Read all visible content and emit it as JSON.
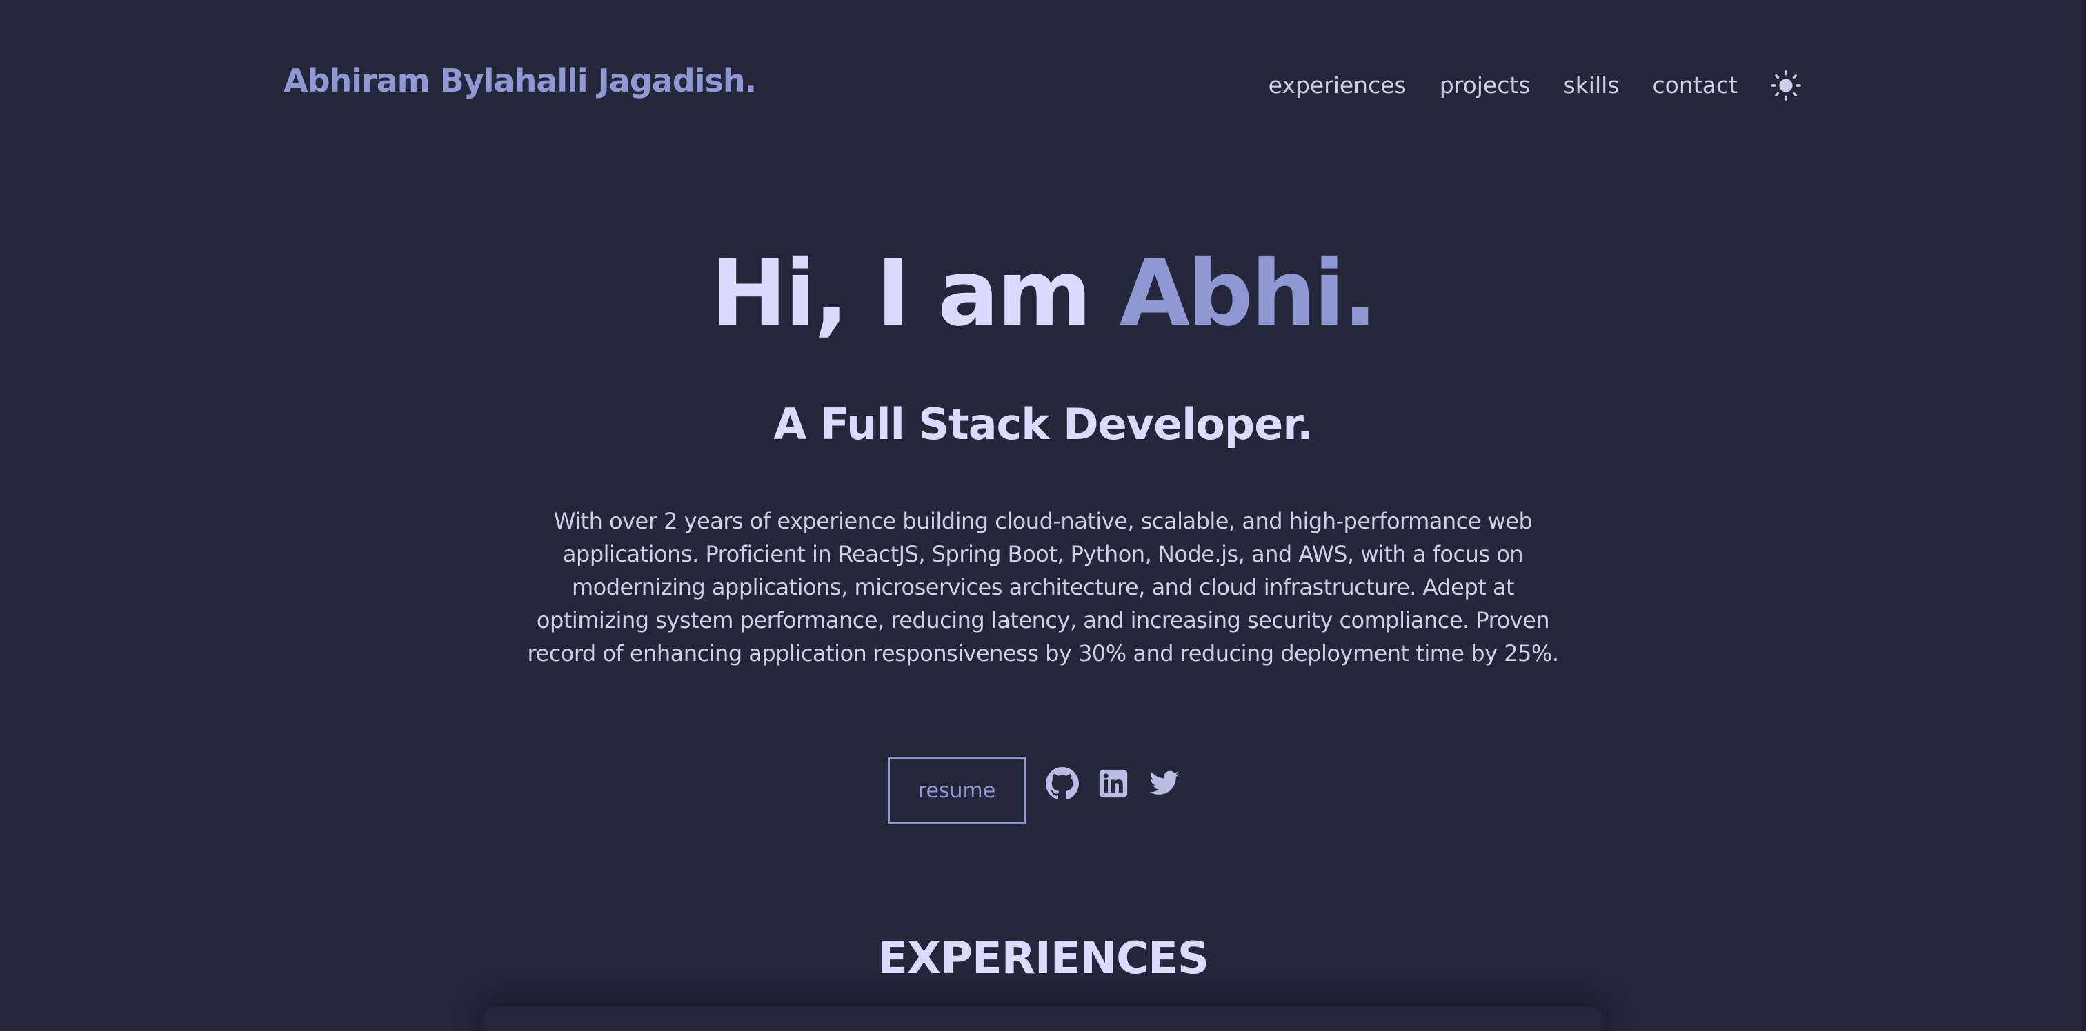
{
  "colors": {
    "background": "#23273a",
    "accent": "#8f98d3",
    "heading": "#dadcff",
    "text": "#cdd0ec"
  },
  "header": {
    "logo": "Abhiram Bylahalli Jagadish.",
    "nav": [
      "experiences",
      "projects",
      "skills",
      "contact"
    ],
    "theme_toggle_icon": "sun-icon"
  },
  "hero": {
    "title_intro": "Hi, I am ",
    "title_name": "Abhi.",
    "subtitle": "A Full Stack Developer.",
    "description": "With over 2 years of experience building cloud-native, scalable, and high-performance web applications. Proficient in ReactJS, Spring Boot, Python, Node.js, and AWS, with a focus on modernizing applications, microservices architecture, and cloud infrastructure. Adept at optimizing system performance, reducing latency, and increasing security compliance. Proven record of enhancing application responsiveness by 30% and reducing deployment time by 25%.",
    "resume_label": "resume",
    "social_icons": [
      "github-icon",
      "linkedin-icon",
      "twitter-icon"
    ]
  },
  "sections": {
    "experiences_title": "EXPERIENCES"
  }
}
